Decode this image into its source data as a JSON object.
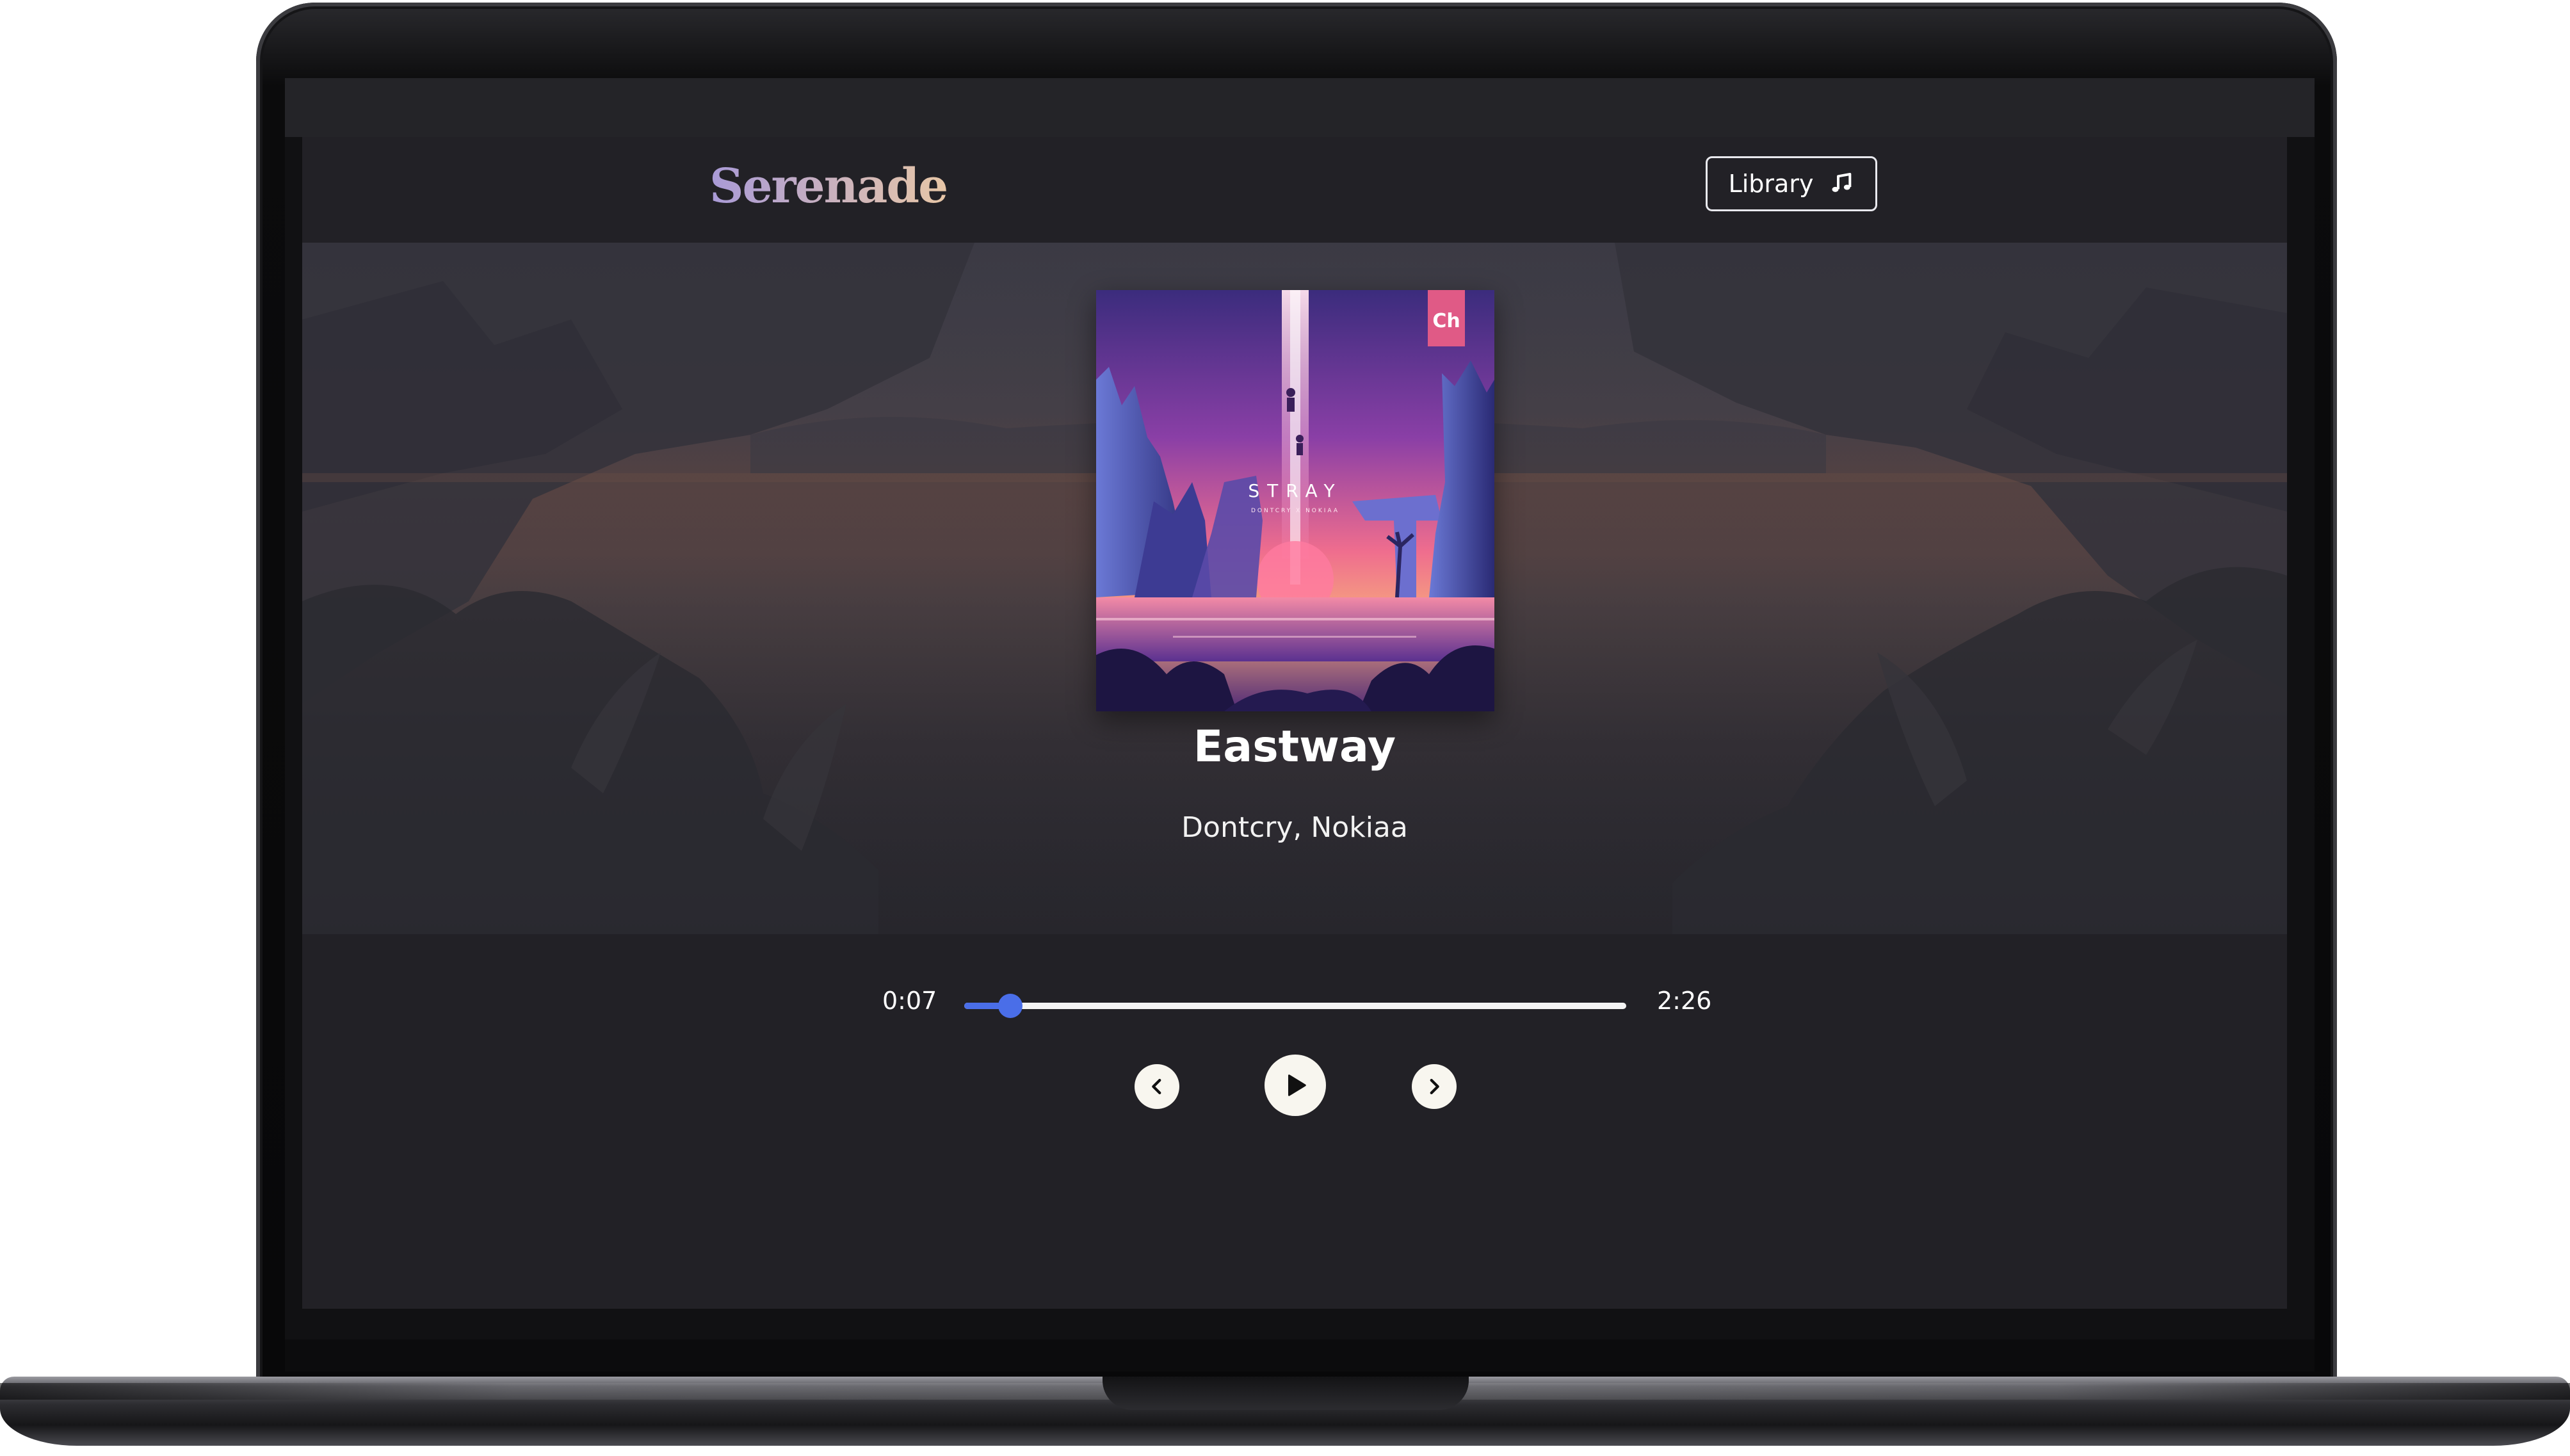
{
  "app": {
    "brand": "Serenade",
    "library_button": {
      "label": "Library",
      "icon": "music-note-icon"
    }
  },
  "now_playing": {
    "title": "Eastway",
    "artist": "Dontcry, Nokiaa",
    "album_art": {
      "title_text": "STRAY",
      "subtitle_text": "DONTCRY X NOKIAA",
      "label_logo": "Ch"
    }
  },
  "player": {
    "current_time": "0:07",
    "total_time": "2:26",
    "progress": 0.07,
    "controls": {
      "prev_icon": "chevron-left-icon",
      "play_icon": "play-icon",
      "next_icon": "chevron-right-icon"
    }
  },
  "colors": {
    "accent": "#4a6ee8",
    "background": "#222126",
    "brand_gradient_start": "#a99ad7",
    "brand_gradient_end": "#e8c7a7"
  }
}
